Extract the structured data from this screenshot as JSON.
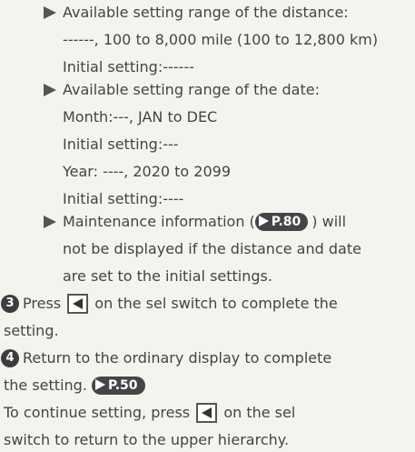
{
  "bullets": {
    "distance": {
      "l1": "Available setting range of the distance:",
      "l2": "------, 100 to 8,000 mile (100 to 12,800 km)",
      "l3": "Initial setting:------"
    },
    "date": {
      "l1": "Available setting range of the date:",
      "l2": "Month:---, JAN to DEC",
      "l3": "Initial setting:---",
      "l4": "Year: ----, 2020 to 2099",
      "l5": "Initial setting:----"
    },
    "maintenance": {
      "l1_before": "Maintenance information (",
      "l1_ref": "P.80",
      "l1_after": ") will",
      "l2": "not be displayed if the distance and date",
      "l3": "are set to the initial settings."
    }
  },
  "steps": {
    "step3": {
      "number": "3",
      "l1_before": "Press",
      "l1_after": "on the sel switch to complete the",
      "l2": "setting."
    },
    "step4": {
      "number": "4",
      "l1": "Return to the ordinary display to complete",
      "l2_text": "the setting.",
      "l2_ref": "P.50",
      "l3_before": "To continue setting, press",
      "l3_after": "on the sel",
      "l4": "switch to return to the upper hierarchy."
    }
  },
  "icons": {
    "bullet": "right-triangle-bullet-icon",
    "reference": "page-reference-arrow-icon",
    "key": "left-button-key-icon"
  },
  "colors": {
    "background": "#f3f4ee",
    "text": "#444444",
    "badge": "#3d3d3d"
  }
}
